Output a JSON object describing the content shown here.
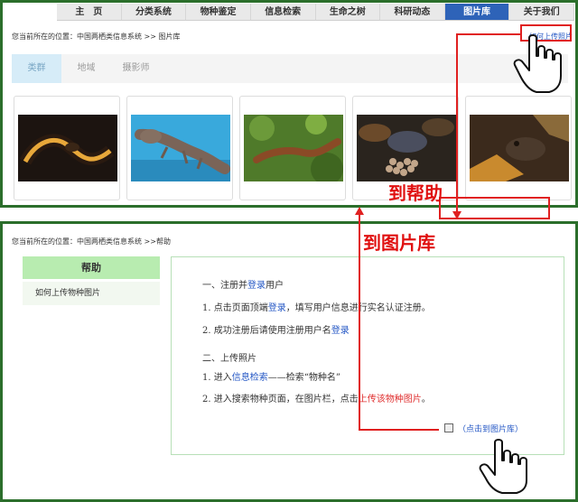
{
  "nav": {
    "items": [
      "主　页",
      "分类系统",
      "物种鉴定",
      "信息检索",
      "生命之树",
      "科研动态",
      "图片库",
      "关于我们"
    ],
    "active_index": 6
  },
  "top": {
    "breadcrumb": "您当前所在的位置：中国两栖类信息系统 >> 图片库",
    "help_link": "如何上传照片",
    "tabs": [
      "类群",
      "地域",
      "摄影师"
    ],
    "active_tab": 0
  },
  "photos": [
    {
      "icon": "amphibian-photo-1"
    },
    {
      "icon": "amphibian-photo-2"
    },
    {
      "icon": "amphibian-photo-3"
    },
    {
      "icon": "amphibian-photo-4"
    },
    {
      "icon": "amphibian-photo-5"
    }
  ],
  "annotations": {
    "to_help": "到帮助",
    "to_gallery": "到图片库",
    "color": "#e01010"
  },
  "bottom": {
    "breadcrumb": "您当前所在的位置：中国两栖类信息系统 >>帮助",
    "sidebar": {
      "title": "帮助",
      "item": "如何上传物种图片"
    },
    "content": {
      "s1_prefix": "一、注册并",
      "s1_link": "登录",
      "s1_suffix": "用户",
      "l1_prefix": "1.  点击页面顶端",
      "l1_link": "登录",
      "l1_suffix": "，填写用户信息进行实名认证注册。",
      "l2_prefix": "2.  成功注册后请使用注册用户名",
      "l2_link": "登录",
      "s2": "二、上传照片",
      "l3_prefix": "1.  进入",
      "l3_link": "信息检索",
      "l3_suffix": "——检索“物种名”",
      "l4_prefix": "2.  进入搜索物种页面，在图片栏，点击",
      "l4_link": "上传该物种图片",
      "l4_suffix": "。",
      "gallery_button": "（点击到图片库）"
    }
  },
  "colors": {
    "frame": "#2b6e2b",
    "nav_active": "#2e63b8",
    "link": "#2457c5",
    "highlight_box": "#e02020",
    "sidebar_title_bg": "#b8ecb0"
  }
}
